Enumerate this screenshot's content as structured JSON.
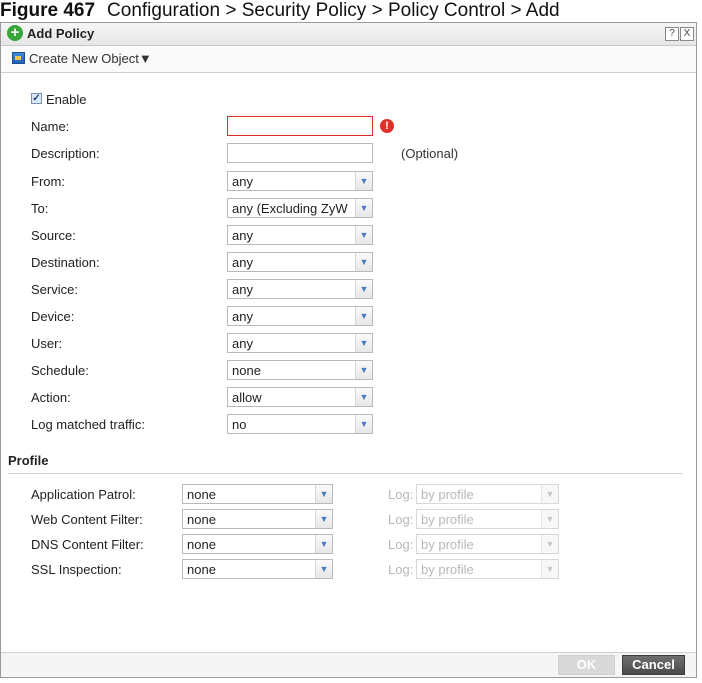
{
  "caption": {
    "figure": "Figure 467",
    "text": "Configuration > Security Policy > Policy Control > Add"
  },
  "dialog": {
    "title": "Add Policy",
    "help_glyph": "?",
    "close_glyph": "X",
    "toolbar": {
      "create_label": "Create New Object▼"
    }
  },
  "form": {
    "enable": {
      "label": "Enable",
      "check": "✓"
    },
    "name": {
      "label": "Name:",
      "value": "",
      "error_glyph": "!"
    },
    "description": {
      "label": "Description:",
      "value": "",
      "optional": "(Optional)"
    },
    "from": {
      "label": "From:",
      "value": "any"
    },
    "to": {
      "label": "To:",
      "value": "any (Excluding ZyW"
    },
    "source": {
      "label": "Source:",
      "value": "any"
    },
    "destination": {
      "label": "Destination:",
      "value": "any"
    },
    "service": {
      "label": "Service:",
      "value": "any"
    },
    "device": {
      "label": "Device:",
      "value": "any"
    },
    "user": {
      "label": "User:",
      "value": "any"
    },
    "schedule": {
      "label": "Schedule:",
      "value": "none"
    },
    "action": {
      "label": "Action:",
      "value": "allow"
    },
    "log_matched": {
      "label": "Log matched traffic:",
      "value": "no"
    }
  },
  "profile": {
    "heading": "Profile",
    "log_label": "Log:",
    "rows": {
      "app_patrol": {
        "label": "Application Patrol:",
        "value": "none",
        "log": "by profile"
      },
      "web_filter": {
        "label": "Web Content Filter:",
        "value": "none",
        "log": "by profile"
      },
      "dns_filter": {
        "label": "DNS Content Filter:",
        "value": "none",
        "log": "by profile"
      },
      "ssl": {
        "label": "SSL Inspection:",
        "value": "none",
        "log": "by profile"
      }
    }
  },
  "footer": {
    "ok": "OK",
    "cancel": "Cancel"
  },
  "dropdown_glyph": "▼"
}
